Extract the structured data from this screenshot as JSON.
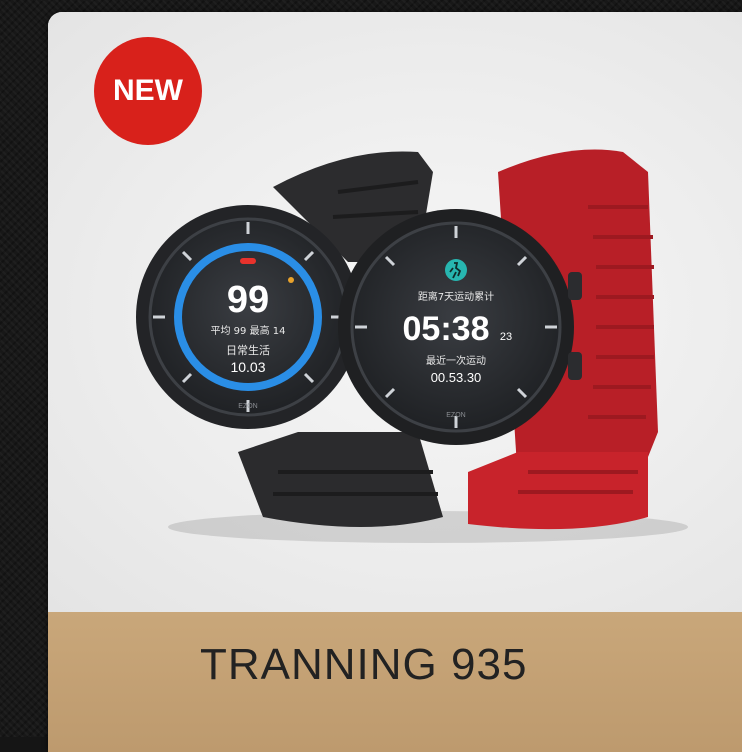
{
  "badge": {
    "label": "NEW",
    "color": "#d8211b"
  },
  "product": {
    "title": "TRANNING 935"
  },
  "watch_left": {
    "main_value": "99",
    "line1": "平均 99  最高 14",
    "line2": "日常生活",
    "line3": "10.03",
    "brand": "EZON",
    "ring_color": "#2a8ee6",
    "strap_color": "#2b2b2d"
  },
  "watch_right": {
    "line1": "距离7天运动累计",
    "time_main": "05:38",
    "time_sub": "23",
    "line2": "最近一次运动",
    "line3": "00.53.30",
    "brand": "EZON",
    "strap_color": "#c8232b",
    "icon": "running-person-icon"
  },
  "colors": {
    "footer": "#c4a173",
    "card": "#ededed"
  }
}
